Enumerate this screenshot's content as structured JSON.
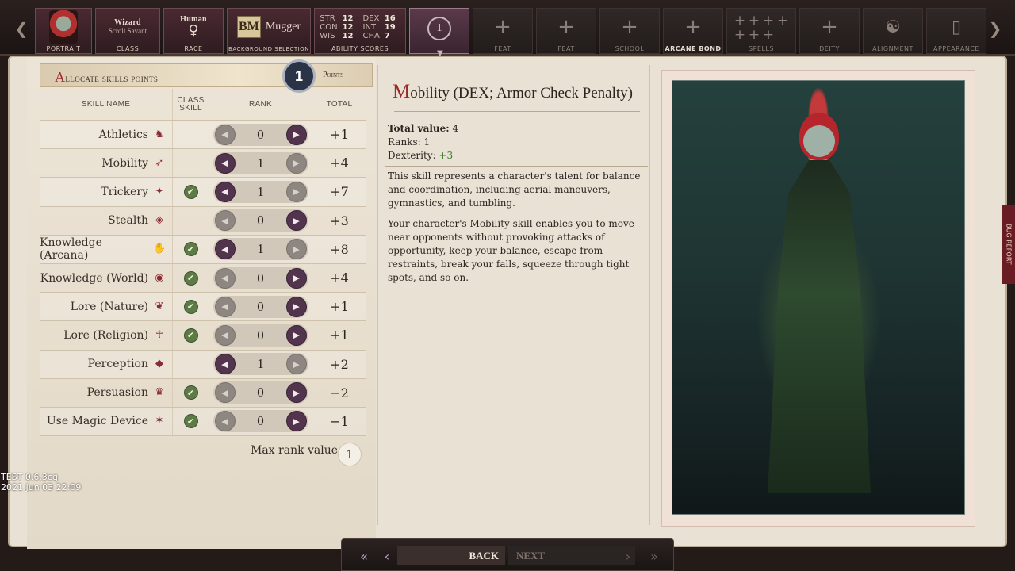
{
  "steps": {
    "portrait": {
      "caption": "Portrait"
    },
    "class": {
      "title": "Wizard",
      "subtitle": "Scroll Savant",
      "caption": "Class"
    },
    "race": {
      "title": "Human",
      "symbol": "♀",
      "caption": "Race"
    },
    "background": {
      "icon": "BM",
      "title": "Mugger",
      "caption": "Background Selection"
    },
    "abilities": {
      "caption": "Ability Scores",
      "scores": [
        {
          "name": "STR",
          "value": "12"
        },
        {
          "name": "DEX",
          "value": "16"
        },
        {
          "name": "CON",
          "value": "12"
        },
        {
          "name": "INT",
          "value": "19"
        },
        {
          "name": "WIS",
          "value": "12"
        },
        {
          "name": "CHA",
          "value": "7"
        }
      ]
    },
    "skills_step": {
      "value": "1"
    },
    "feat1": {
      "caption": "Feat"
    },
    "feat2": {
      "caption": "Feat"
    },
    "school": {
      "caption": "School"
    },
    "arcane_bond": {
      "caption": "Arcane Bond"
    },
    "spells": {
      "caption": "Spells"
    },
    "deity": {
      "caption": "Deity"
    },
    "alignment": {
      "caption": "Alignment"
    },
    "appearance": {
      "caption": "Appearance"
    }
  },
  "skills_panel": {
    "title_first": "A",
    "title_rest": "llocate skills points",
    "points": "1",
    "points_label": "Points",
    "headers": {
      "name": "Skill Name",
      "class": "Class Skill",
      "rank": "Rank",
      "total": "Total"
    },
    "rows": [
      {
        "name": "Athletics",
        "icon": "♞",
        "class_skill": false,
        "rank": "0",
        "total": "+1",
        "minus_on": false
      },
      {
        "name": "Mobility",
        "icon": "➶",
        "class_skill": false,
        "rank": "1",
        "total": "+4",
        "minus_on": true
      },
      {
        "name": "Trickery",
        "icon": "✦",
        "class_skill": true,
        "rank": "1",
        "total": "+7",
        "minus_on": true
      },
      {
        "name": "Stealth",
        "icon": "◈",
        "class_skill": false,
        "rank": "0",
        "total": "+3",
        "minus_on": false
      },
      {
        "name": "Knowledge (Arcana)",
        "icon": "✋",
        "class_skill": true,
        "rank": "1",
        "total": "+8",
        "minus_on": true
      },
      {
        "name": "Knowledge (World)",
        "icon": "◉",
        "class_skill": true,
        "rank": "0",
        "total": "+4",
        "minus_on": false
      },
      {
        "name": "Lore (Nature)",
        "icon": "❦",
        "class_skill": true,
        "rank": "0",
        "total": "+1",
        "minus_on": false
      },
      {
        "name": "Lore (Religion)",
        "icon": "☥",
        "class_skill": true,
        "rank": "0",
        "total": "+1",
        "minus_on": false
      },
      {
        "name": "Perception",
        "icon": "◆",
        "class_skill": false,
        "rank": "1",
        "total": "+2",
        "minus_on": true
      },
      {
        "name": "Persuasion",
        "icon": "♛",
        "class_skill": true,
        "rank": "0",
        "total": "−2",
        "minus_on": false
      },
      {
        "name": "Use Magic Device",
        "icon": "✶",
        "class_skill": true,
        "rank": "0",
        "total": "−1",
        "minus_on": false
      }
    ],
    "max_rank_label": "Max rank value",
    "max_rank_value": "1"
  },
  "description": {
    "title_first": "M",
    "title_rest": "obility (DEX; Armor Check Penalty)",
    "total_label": "Total value:",
    "total_value": "4",
    "ranks_label": "Ranks:",
    "ranks_value": "1",
    "dex_label": "Dexterity:",
    "dex_value": "+3",
    "paragraph1": "This skill represents a character's talent for balance and coordination, including aerial maneuvers, gymnastics, and tumbling.",
    "paragraph2": "Your character's Mobility skill enables you to move near opponents without provoking attacks of opportunity, keep your balance, escape from restraints, break your falls, squeeze through tight spots, and so on."
  },
  "debug": {
    "line1": "TEST 0.6.3cq",
    "line2": "2021 Jun 03 22:09"
  },
  "side_tab": {
    "text": "BUG REPORT"
  },
  "bottom_nav": {
    "back": "BACK",
    "next": "NEXT"
  },
  "colors": {
    "accent_red": "#9a2a2a",
    "rank_button": "#53344d",
    "class_check": "#5e7a46"
  }
}
